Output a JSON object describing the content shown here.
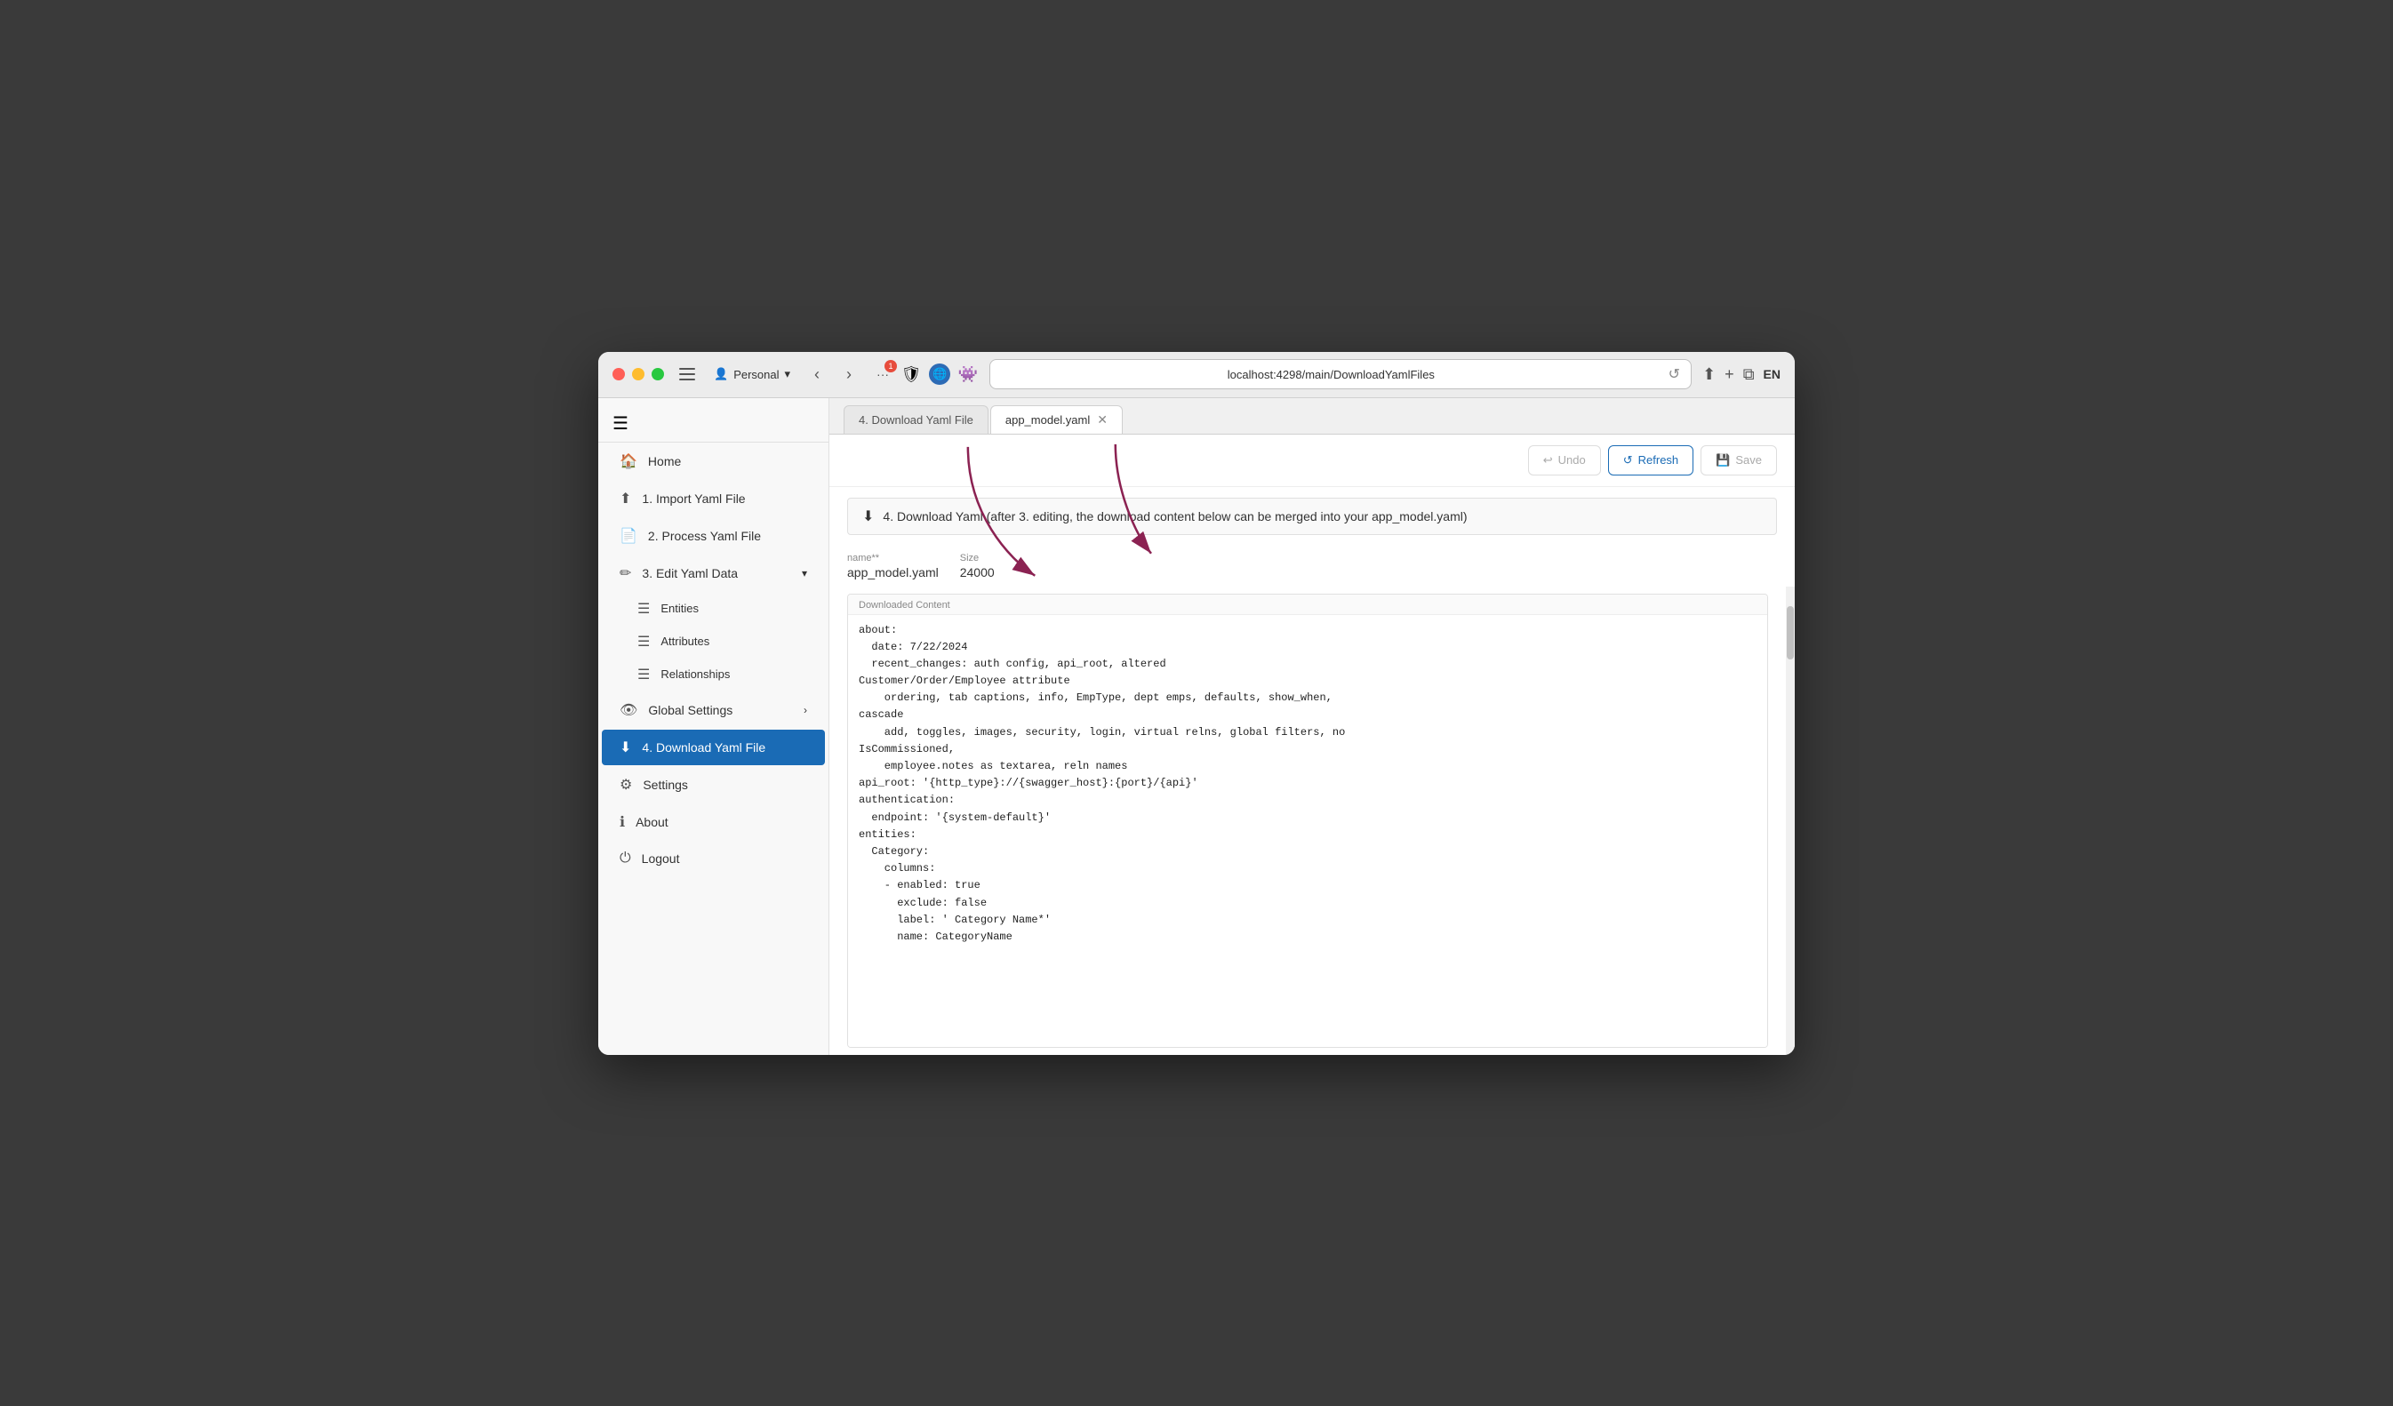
{
  "browser": {
    "url": "localhost:4298/main/DownloadYamlFiles",
    "profile": "Personal",
    "lang": "EN"
  },
  "tabs": [
    {
      "id": "download-yaml",
      "label": "4. Download Yaml File",
      "active": false,
      "closeable": false
    },
    {
      "id": "app-model",
      "label": "app_model.yaml",
      "active": true,
      "closeable": true
    }
  ],
  "toolbar": {
    "undo_label": "Undo",
    "refresh_label": "Refresh",
    "save_label": "Save"
  },
  "sidebar": {
    "hamburger_label": "☰",
    "items": [
      {
        "id": "home",
        "icon": "🏠",
        "label": "Home",
        "active": false
      },
      {
        "id": "import",
        "icon": "⬆",
        "label": "1. Import Yaml File",
        "active": false
      },
      {
        "id": "process",
        "icon": "📄",
        "label": "2. Process Yaml File",
        "active": false
      },
      {
        "id": "edit",
        "icon": "✏",
        "label": "3. Edit Yaml Data",
        "active": false,
        "expandable": true
      },
      {
        "id": "entities",
        "icon": "☰",
        "label": "Entities",
        "active": false,
        "sub": true
      },
      {
        "id": "attributes",
        "icon": "☰",
        "label": "Attributes",
        "active": false,
        "sub": true
      },
      {
        "id": "relationships",
        "icon": "☰",
        "label": "Relationships",
        "active": false,
        "sub": true
      },
      {
        "id": "global-settings",
        "icon": "👁",
        "label": "Global Settings",
        "active": false,
        "expandable": true
      },
      {
        "id": "download",
        "icon": "⬇",
        "label": "4. Download Yaml File",
        "active": true
      },
      {
        "id": "settings",
        "icon": "⚙",
        "label": "Settings",
        "active": false
      },
      {
        "id": "about",
        "icon": "ℹ",
        "label": "About",
        "active": false
      },
      {
        "id": "logout",
        "icon": "⏻",
        "label": "Logout",
        "active": false
      }
    ]
  },
  "download_panel": {
    "header": "4. Download Yaml (after 3. editing, the download content below can be merged into your app_model.yaml)",
    "name_label": "name**",
    "name_value": "app_model.yaml",
    "size_label": "Size",
    "size_value": "24000",
    "downloaded_content_label": "Downloaded Content",
    "content_lines": [
      "about:",
      "  date: 7/22/2024",
      "  recent_changes: auth config, api_root, altered",
      "Customer/Order/Employee attribute",
      "    ordering, tab captions, info, EmpType, dept emps, defaults, show_when,",
      "cascade",
      "    add, toggles, images, security, login, virtual relns, global filters, no",
      "IsCommissioned,",
      "    employee.notes as textarea, reln names",
      "api_root: '{http_type}://{swagger_host}:{port}/{api}'",
      "authentication:",
      "  endpoint: '{system-default}'",
      "entities:",
      "  Category:",
      "    columns:",
      "    - enabled: true",
      "      exclude: false",
      "      label: ' Category Name*'",
      "      name: CategoryName"
    ]
  }
}
